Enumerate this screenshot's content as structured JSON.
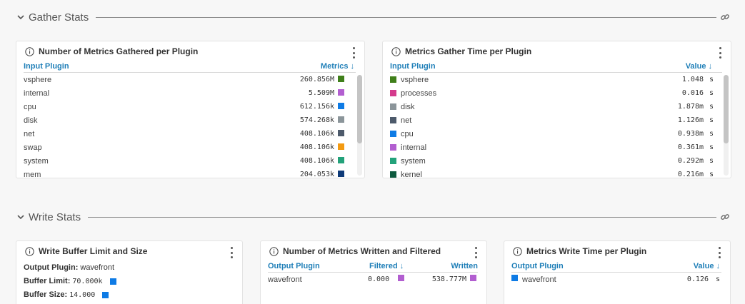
{
  "colors": {
    "accent": "#1f7fb8",
    "vsphere": "#3f7f1a",
    "internal": "#b25ed0",
    "cpu": "#0e7be5",
    "disk": "#8b959a",
    "net": "#4d5a6b",
    "swap": "#f39a12",
    "system": "#23a27a",
    "mem": "#0e3a78",
    "processes": "#d43b8d",
    "kernel": "#0d5a3e"
  },
  "gather_stats": {
    "title": "Gather Stats",
    "collapse_icon": "chevron-down-icon",
    "link_icon": "link-icon"
  },
  "metrics_gathered": {
    "title": "Number of Metrics Gathered per Plugin",
    "col_plugin": "Input Plugin",
    "col_metrics": "Metrics ↓",
    "rows": [
      {
        "name": "vsphere",
        "value": "260.856M",
        "color": "#3f7f1a"
      },
      {
        "name": "internal",
        "value": "5.509M",
        "color": "#b25ed0"
      },
      {
        "name": "cpu",
        "value": "612.156k",
        "color": "#0e7be5"
      },
      {
        "name": "disk",
        "value": "574.268k",
        "color": "#8b959a"
      },
      {
        "name": "net",
        "value": "408.106k",
        "color": "#4d5a6b"
      },
      {
        "name": "swap",
        "value": "408.106k",
        "color": "#f39a12"
      },
      {
        "name": "system",
        "value": "408.106k",
        "color": "#23a27a"
      },
      {
        "name": "mem",
        "value": "204.053k",
        "color": "#0e3a78"
      }
    ]
  },
  "gather_time": {
    "title": "Metrics Gather Time per Plugin",
    "col_plugin": "Input Plugin",
    "col_value": "Value ↓",
    "rows": [
      {
        "name": "vsphere",
        "value": "1.048",
        "unit": "s",
        "color": "#3f7f1a"
      },
      {
        "name": "processes",
        "value": "0.016",
        "unit": "s",
        "color": "#d43b8d"
      },
      {
        "name": "disk",
        "value": "1.878m",
        "unit": "s",
        "color": "#8b959a"
      },
      {
        "name": "net",
        "value": "1.126m",
        "unit": "s",
        "color": "#4d5a6b"
      },
      {
        "name": "cpu",
        "value": "0.938m",
        "unit": "s",
        "color": "#0e7be5"
      },
      {
        "name": "internal",
        "value": "0.361m",
        "unit": "s",
        "color": "#b25ed0"
      },
      {
        "name": "system",
        "value": "0.292m",
        "unit": "s",
        "color": "#23a27a"
      },
      {
        "name": "kernel",
        "value": "0.216m",
        "unit": "s",
        "color": "#0d5a3e"
      }
    ]
  },
  "write_stats": {
    "title": "Write Stats",
    "collapse_icon": "chevron-down-icon",
    "link_icon": "link-icon"
  },
  "write_buffer": {
    "title": "Write Buffer Limit and Size",
    "output_plugin_label": "Output Plugin:",
    "output_plugin_value": "wavefront",
    "buffer_limit_label": "Buffer Limit:",
    "buffer_limit_value": "70.000k",
    "buffer_size_label": "Buffer Size:",
    "buffer_size_value": "14.000",
    "swatch_color": "#0e7be5"
  },
  "written_filtered": {
    "title": "Number of Metrics Written and Filtered",
    "col_plugin": "Output Plugin",
    "col_filtered": "Filtered ↓",
    "col_written": "Written",
    "rows": [
      {
        "name": "wavefront",
        "filtered": "0.000",
        "written": "538.777M",
        "color": "#b25ed0"
      }
    ]
  },
  "write_time": {
    "title": "Metrics Write Time per Plugin",
    "col_plugin": "Output Plugin",
    "col_value": "Value ↓",
    "rows": [
      {
        "name": "wavefront",
        "value": "0.126",
        "unit": "s",
        "color": "#0e7be5"
      }
    ]
  }
}
